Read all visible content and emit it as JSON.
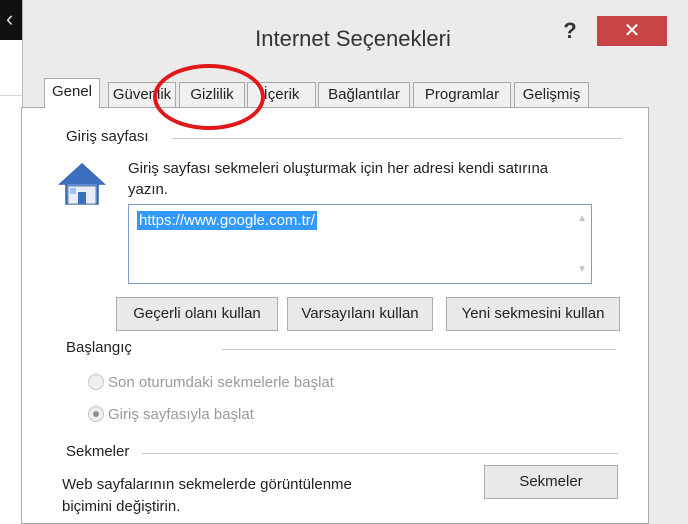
{
  "window": {
    "title": "Internet Seçenekleri",
    "help_label": "?",
    "close_label": "✕"
  },
  "tabs": [
    {
      "label": "Genel",
      "active": true
    },
    {
      "label": "Güvenlik"
    },
    {
      "label": "Gizlilik"
    },
    {
      "label": "İçerik"
    },
    {
      "label": "Bağlantılar"
    },
    {
      "label": "Programlar"
    },
    {
      "label": "Gelişmiş"
    }
  ],
  "home_page": {
    "group_label": "Giriş sayfası",
    "icon": "house-icon",
    "description": "Giriş sayfası sekmeleri oluşturmak için her adresi kendi satırına yazın.",
    "url_value": "https://www.google.com.tr/",
    "buttons": {
      "use_current": "Geçerli olanı kullan",
      "use_default": "Varsayılanı kullan",
      "use_new_tab": "Yeni sekmesini kullan"
    }
  },
  "startup": {
    "group_label": "Başlangıç",
    "options": [
      {
        "label": "Son oturumdaki sekmelerle başlat",
        "checked": false
      },
      {
        "label": "Giriş sayfasıyla başlat",
        "checked": true
      }
    ]
  },
  "tabs_section": {
    "group_label": "Sekmeler",
    "description": "Web sayfalarının sekmelerde görüntülenme biçimini değiştirin.",
    "button_label": "Sekmeler"
  },
  "colors": {
    "annotation_circle": "#e01818",
    "close_button": "#c94444",
    "selection": "#3399ff"
  }
}
